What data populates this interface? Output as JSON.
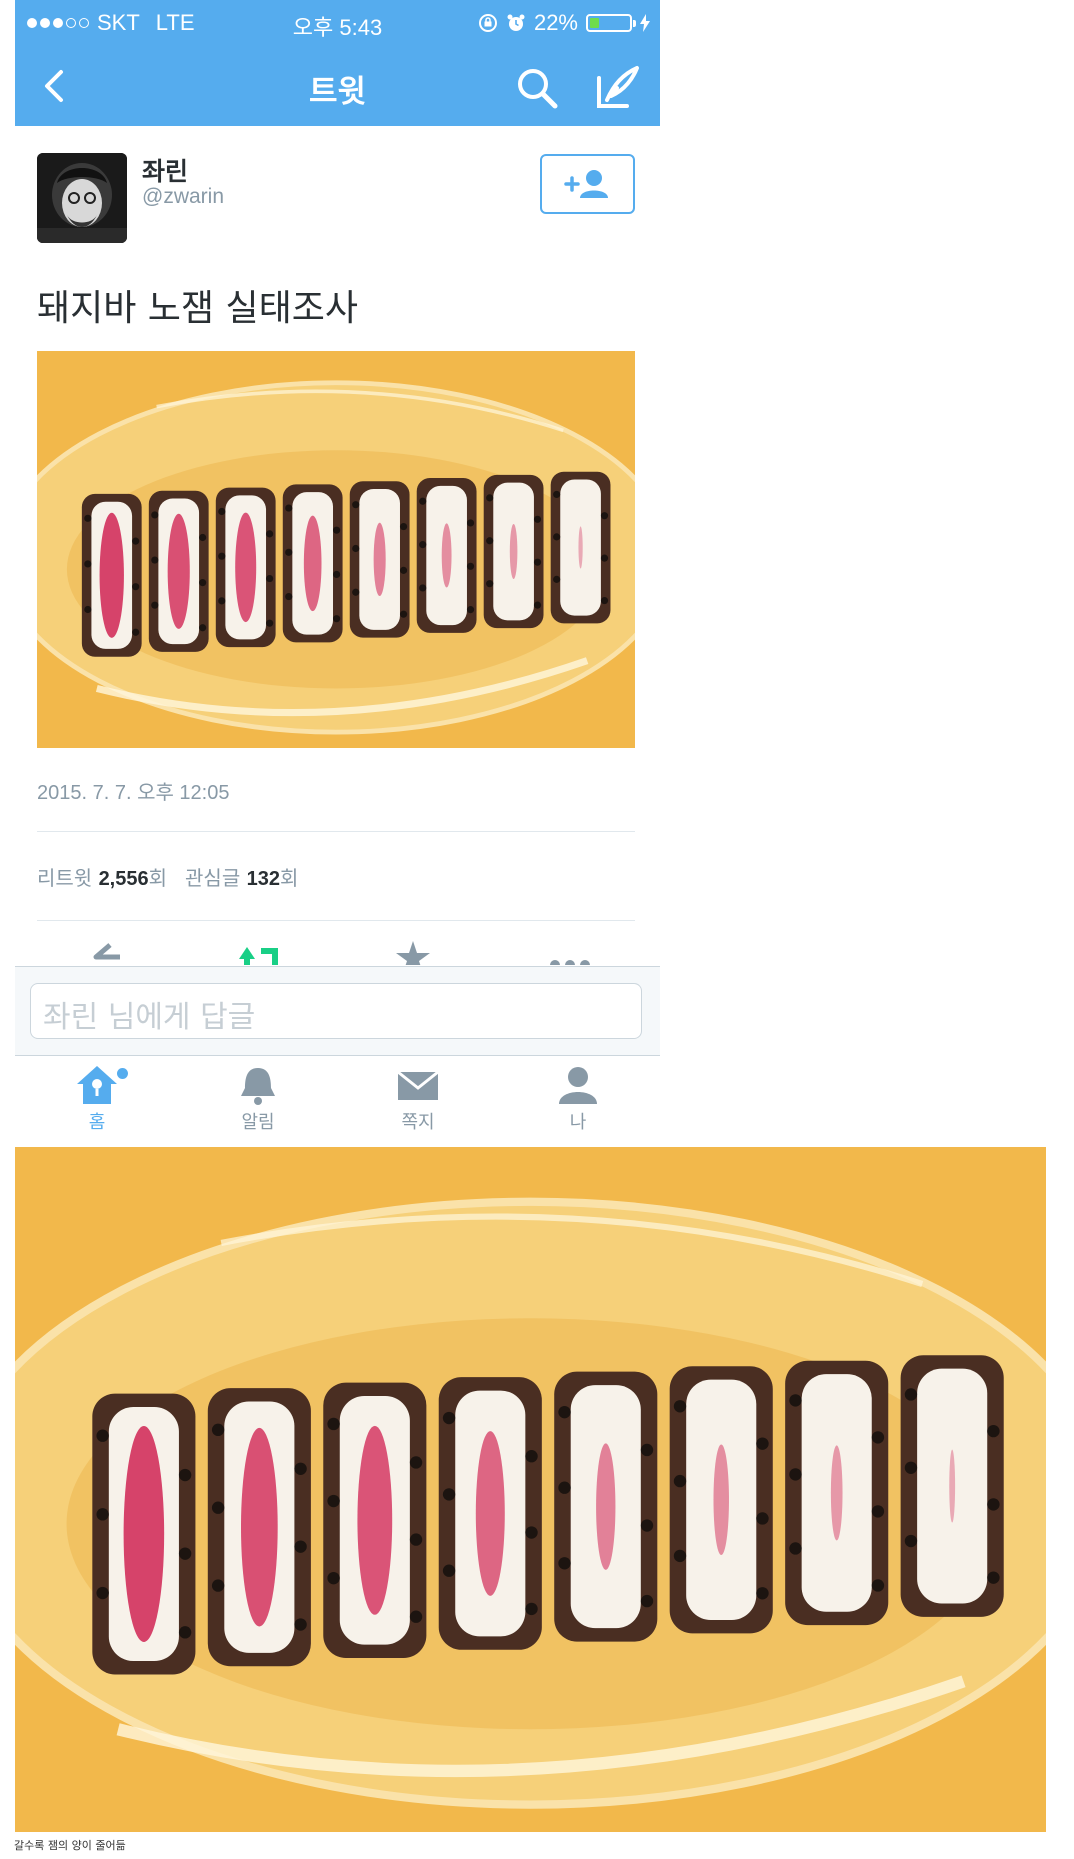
{
  "status_bar": {
    "carrier": "SKT",
    "network": "LTE",
    "time": "오후 5:43",
    "battery_percent": "22%",
    "battery_level": 0.22,
    "signal_bars_filled": 3,
    "signal_bars_total": 5
  },
  "nav": {
    "title": "트윗"
  },
  "tweet": {
    "author_name": "좌린",
    "author_handle": "@zwarin",
    "text": "돼지바 노잼 실태조사",
    "timestamp": "2015. 7. 7. 오후 12:05",
    "stats": {
      "retweet_label": "리트윗",
      "retweet_count": "2,556",
      "retweet_unit": "회",
      "favorite_label": "관심글",
      "favorite_count": "132",
      "favorite_unit": "회"
    }
  },
  "reply": {
    "placeholder": "좌린 님에게 답글"
  },
  "tabs": [
    {
      "label": "홈",
      "icon": "home-icon",
      "active": true
    },
    {
      "label": "알림",
      "icon": "bell-icon",
      "active": false
    },
    {
      "label": "쪽지",
      "icon": "envelope-icon",
      "active": false
    },
    {
      "label": "나",
      "icon": "person-icon",
      "active": false
    }
  ],
  "caption": "갈수록 잼의 양이 줄어듦",
  "colors": {
    "twitter_blue": "#55acee",
    "plate_background": "#f2b84b",
    "jam_red": "#d6436a"
  },
  "photo": {
    "slices": 8,
    "jam_amounts": [
      1.0,
      0.9,
      0.85,
      0.7,
      0.45,
      0.35,
      0.25,
      0.1
    ]
  }
}
